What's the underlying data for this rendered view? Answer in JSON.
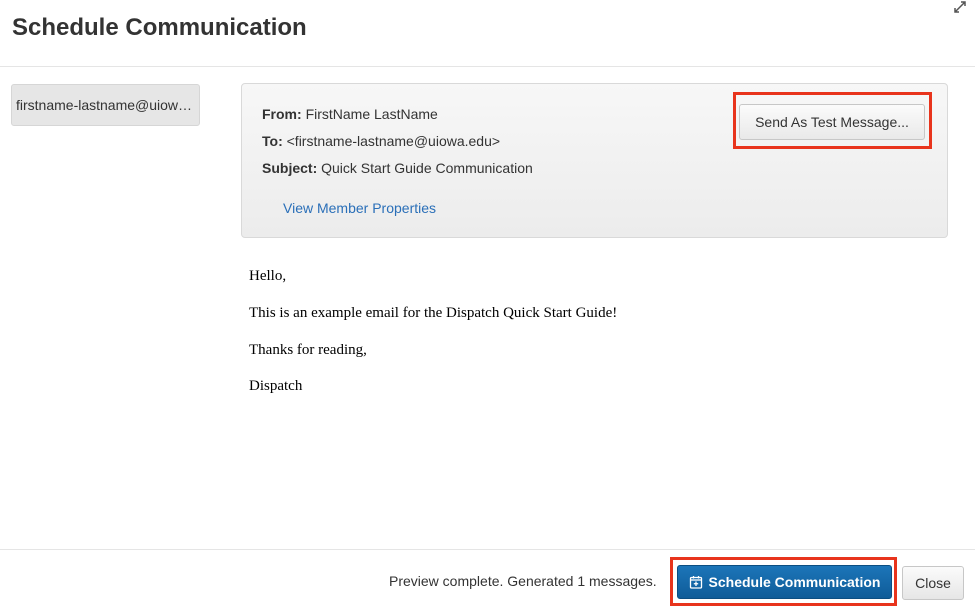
{
  "modal": {
    "title": "Schedule Communication"
  },
  "recipients": {
    "selected": "firstname-lastname@uiowa.edu"
  },
  "message": {
    "from_label": "From:",
    "from_value": "FirstName LastName",
    "to_label": "To:",
    "to_value": "<firstname-lastname@uiowa.edu>",
    "subject_label": "Subject:",
    "subject_value": "Quick Start Guide Communication",
    "member_properties_link": "View Member Properties",
    "send_test_label": "Send As Test Message...",
    "body_lines": [
      "Hello,",
      "This is an example email for the Dispatch Quick Start Guide!",
      "Thanks for reading,",
      "Dispatch"
    ]
  },
  "footer": {
    "status": "Preview complete. Generated 1 messages.",
    "schedule_label": "Schedule Communication",
    "close_label": "Close"
  },
  "colors": {
    "primary_button": "#0f5c98",
    "link": "#2a6fb8",
    "highlight": "#e8341c"
  },
  "icons": {
    "expand": "expand-arrows-icon",
    "calendar": "calendar-plus-icon"
  }
}
